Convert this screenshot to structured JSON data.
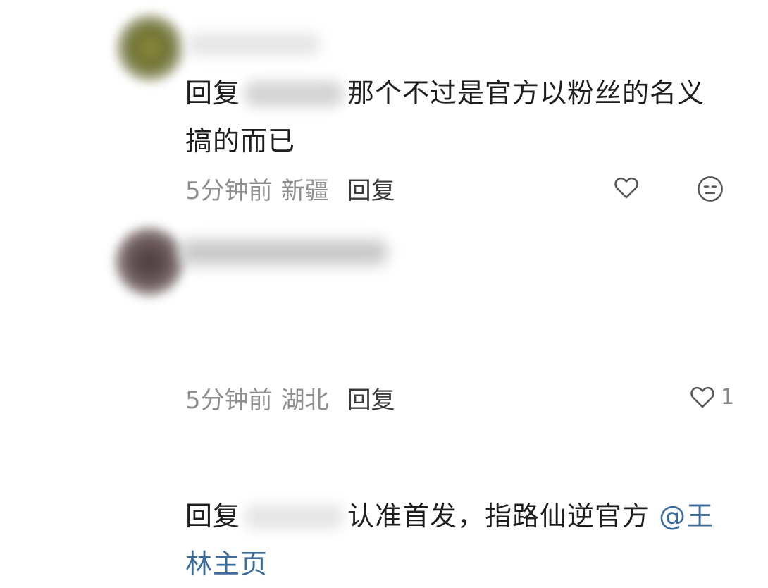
{
  "comments": [
    {
      "reply_prefix": "回复",
      "text": "那个不过是官方以粉丝的名义搞的而已",
      "time": "5分钟前",
      "location": "新疆",
      "reply_label": "回复"
    },
    {
      "reply_prefix": "回复",
      "text": "认准首发，指路仙逆官方 ",
      "mention": "@王林主页",
      "time": "5分钟前",
      "location": "湖北",
      "reply_label": "回复",
      "likes": "1"
    }
  ],
  "colors": {
    "text": "#1e1e1e",
    "meta": "#8f8f8f",
    "mention": "#3b6c9e",
    "icon": "#555555"
  },
  "icons": [
    "heart-outline-icon",
    "expressionless-face-icon"
  ]
}
